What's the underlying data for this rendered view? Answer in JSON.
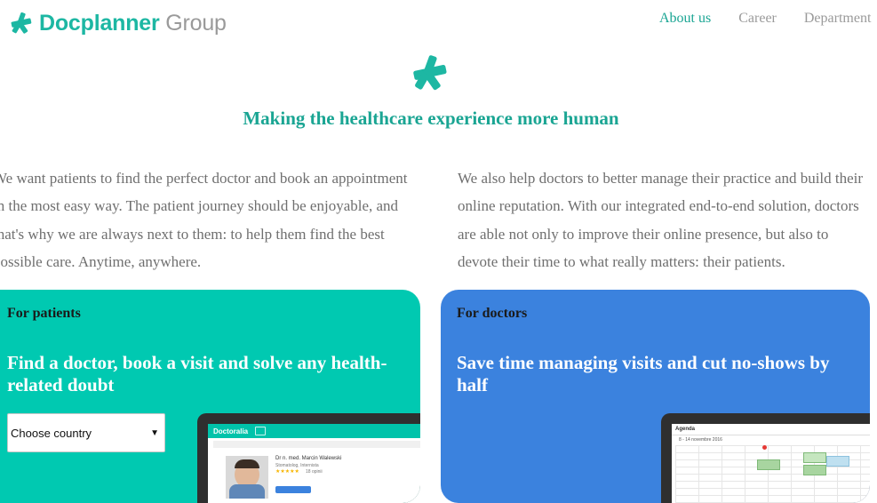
{
  "header": {
    "logo_brand": "Docplanner",
    "logo_group": "Group",
    "nav": [
      {
        "label": "About us",
        "active": true
      },
      {
        "label": "Career",
        "active": false
      },
      {
        "label": "Department",
        "active": false
      }
    ]
  },
  "hero": {
    "headline": "Making the healthcare experience more human"
  },
  "intro": {
    "left": "We want patients to find the perfect doctor and book an appointment in the most easy way. The patient journey should be enjoyable, and that's why we are always next to them: to help them find the best possible care. Anytime, anywhere.",
    "right": "We also help doctors to better manage their practice and build their online reputation. With our integrated end-to-end solution, doctors are able not only to improve their online presence, but also to devote their time to what really matters: their patients."
  },
  "cards": {
    "patients": {
      "label": "For patients",
      "title": "Find a doctor, book a visit and solve any health-related doubt",
      "select": {
        "value": "Choose country",
        "arrow": "▼"
      },
      "preview": {
        "logo": "Doctoralia",
        "doctor_name": "Dr n. med. Marcin Walewski",
        "speciality": "Stomatolog, Internista",
        "stars": "★★★★★",
        "reviews": "18 opinii"
      }
    },
    "doctors": {
      "label": "For doctors",
      "title": "Save time managing visits and cut no-shows by half",
      "preview": {
        "calendar_title": "Agenda",
        "date_range": "8 - 14 novembre 2016"
      }
    }
  },
  "colors": {
    "brand_teal": "#1db7a3",
    "patients_card": "#00c9b1",
    "doctors_card": "#3b82de"
  }
}
